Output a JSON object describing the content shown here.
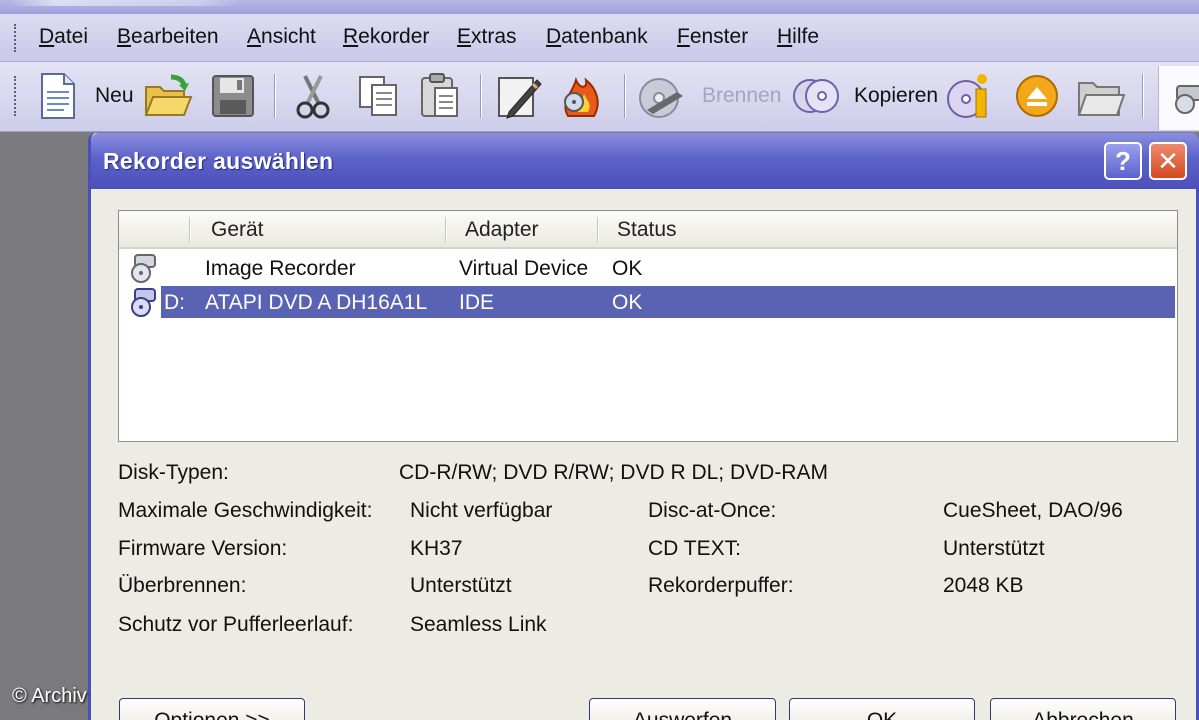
{
  "menu": {
    "items": [
      "Datei",
      "Bearbeiten",
      "Ansicht",
      "Rekorder",
      "Extras",
      "Datenbank",
      "Fenster",
      "Hilfe"
    ]
  },
  "toolbar": {
    "new_label": "Neu",
    "burn_label": "Brennen",
    "copy_label": "Kopieren",
    "icons": [
      "new-document-icon",
      "open-folder-icon",
      "save-icon",
      "cut-icon",
      "copy-icon",
      "paste-icon",
      "edit-compilation-icon",
      "erase-disc-icon",
      "burn-icon",
      "copy-disc-icon",
      "disc-info-icon",
      "eject-icon",
      "open-icon",
      "recorder-icon"
    ]
  },
  "dialog": {
    "title": "Rekorder auswählen",
    "help_glyph": "?",
    "close_glyph": "✕",
    "columns": [
      "Gerät",
      "Adapter",
      "Status"
    ],
    "rows": [
      {
        "drive": "",
        "name": "Image Recorder",
        "adapter": "Virtual Device",
        "status": "OK",
        "selected": false
      },
      {
        "drive": "D:",
        "name": "ATAPI DVD A  DH16A1L",
        "adapter": "IDE",
        "status": "OK",
        "selected": true
      }
    ],
    "info": {
      "disk_types_label": "Disk-Typen:",
      "disk_types_value": "CD-R/RW; DVD R/RW; DVD R DL; DVD-RAM",
      "max_speed_label": "Maximale Geschwindigkeit:",
      "max_speed_value": "Nicht verfügbar",
      "dao_label": "Disc-at-Once:",
      "dao_value": "CueSheet, DAO/96",
      "firmware_label": "Firmware Version:",
      "firmware_value": "KH37",
      "cdtext_label": "CD TEXT:",
      "cdtext_value": "Unterstützt",
      "overburn_label": "Überbrennen:",
      "overburn_value": "Unterstützt",
      "buffer_label": "Rekorderpuffer:",
      "buffer_value": "2048 KB",
      "underrun_label": "Schutz vor Pufferleerlauf:",
      "underrun_value": "Seamless Link"
    },
    "buttons": {
      "options": "Optionen >>",
      "eject": "Auswerfen",
      "ok": "OK",
      "cancel": "Abbrechen"
    }
  },
  "watermark": "© Archiv",
  "colors": {
    "title_bar": "#4b50bb",
    "selection": "#5a63b3",
    "dialog_bg": "#ecebe4",
    "close_button": "#d44a22"
  }
}
